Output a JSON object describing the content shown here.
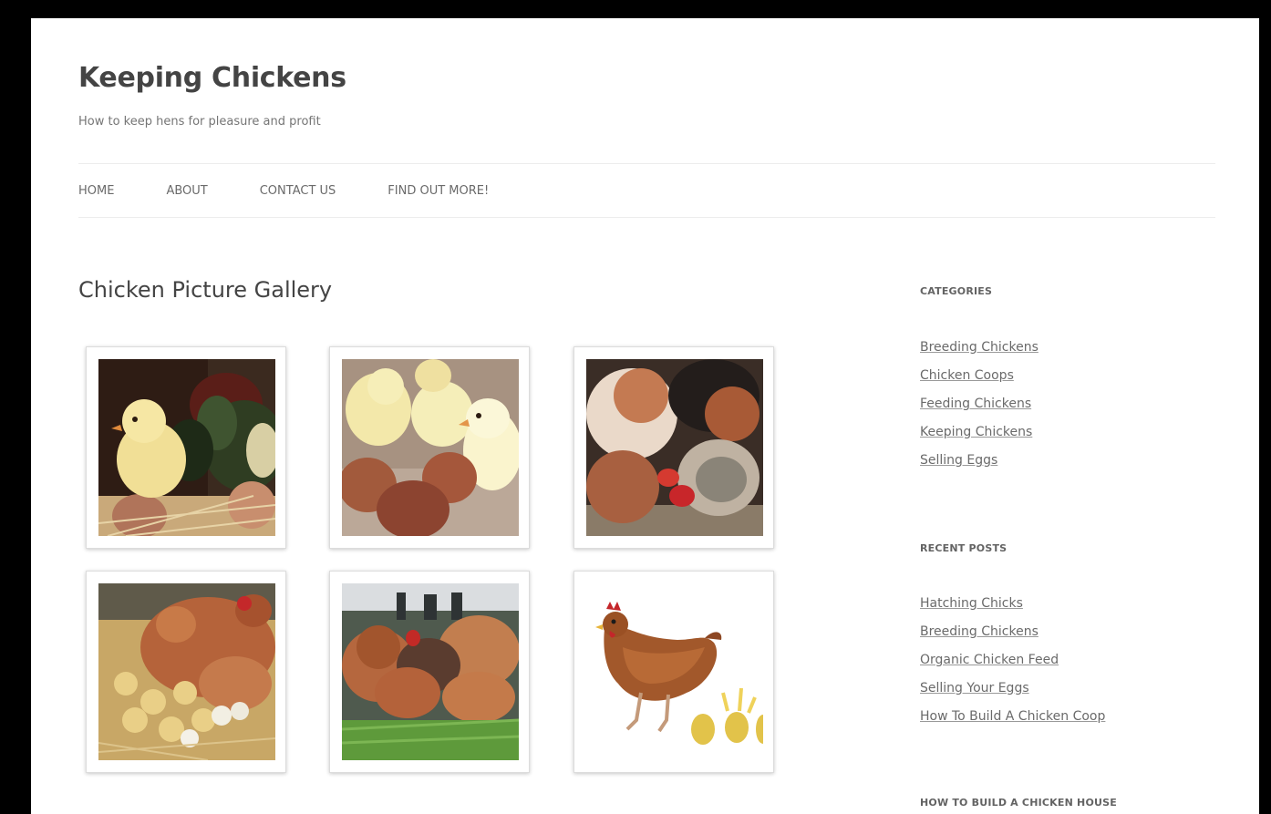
{
  "site": {
    "title": "Keeping Chickens",
    "tagline": "How to keep hens for pleasure and profit"
  },
  "nav": [
    {
      "label": "HOME"
    },
    {
      "label": "ABOUT"
    },
    {
      "label": "CONTACT US"
    },
    {
      "label": "FIND OUT MORE!"
    }
  ],
  "page": {
    "title": "Chicken Picture Gallery"
  },
  "gallery": [
    {
      "subject": "chick-with-eggs-photo"
    },
    {
      "subject": "chicks-and-brown-eggs-photo"
    },
    {
      "subject": "hens-pecking-photo"
    },
    {
      "subject": "hen-with-chicks-photo"
    },
    {
      "subject": "hens-on-grass-photo"
    },
    {
      "subject": "hen-laying-eggs-illustration"
    }
  ],
  "sidebar": {
    "categories": {
      "title": "CATEGORIES",
      "items": [
        {
          "label": "Breeding Chickens"
        },
        {
          "label": "Chicken Coops"
        },
        {
          "label": "Feeding Chickens"
        },
        {
          "label": "Keeping Chickens"
        },
        {
          "label": "Selling Eggs"
        }
      ]
    },
    "recent_posts": {
      "title": "RECENT POSTS",
      "items": [
        {
          "label": "Hatching Chicks"
        },
        {
          "label": "Breeding Chickens"
        },
        {
          "label": "Organic Chicken Feed"
        },
        {
          "label": "Selling Your Eggs"
        },
        {
          "label": "How To Build A Chicken Coop"
        }
      ]
    },
    "chicken_house": {
      "title": "HOW TO BUILD A CHICKEN HOUSE"
    }
  },
  "colors": {
    "page_bg": "#ffffff",
    "frame_bg": "#000000",
    "text": "#444444",
    "link": "#6a6a6a",
    "border": "#ececec"
  }
}
